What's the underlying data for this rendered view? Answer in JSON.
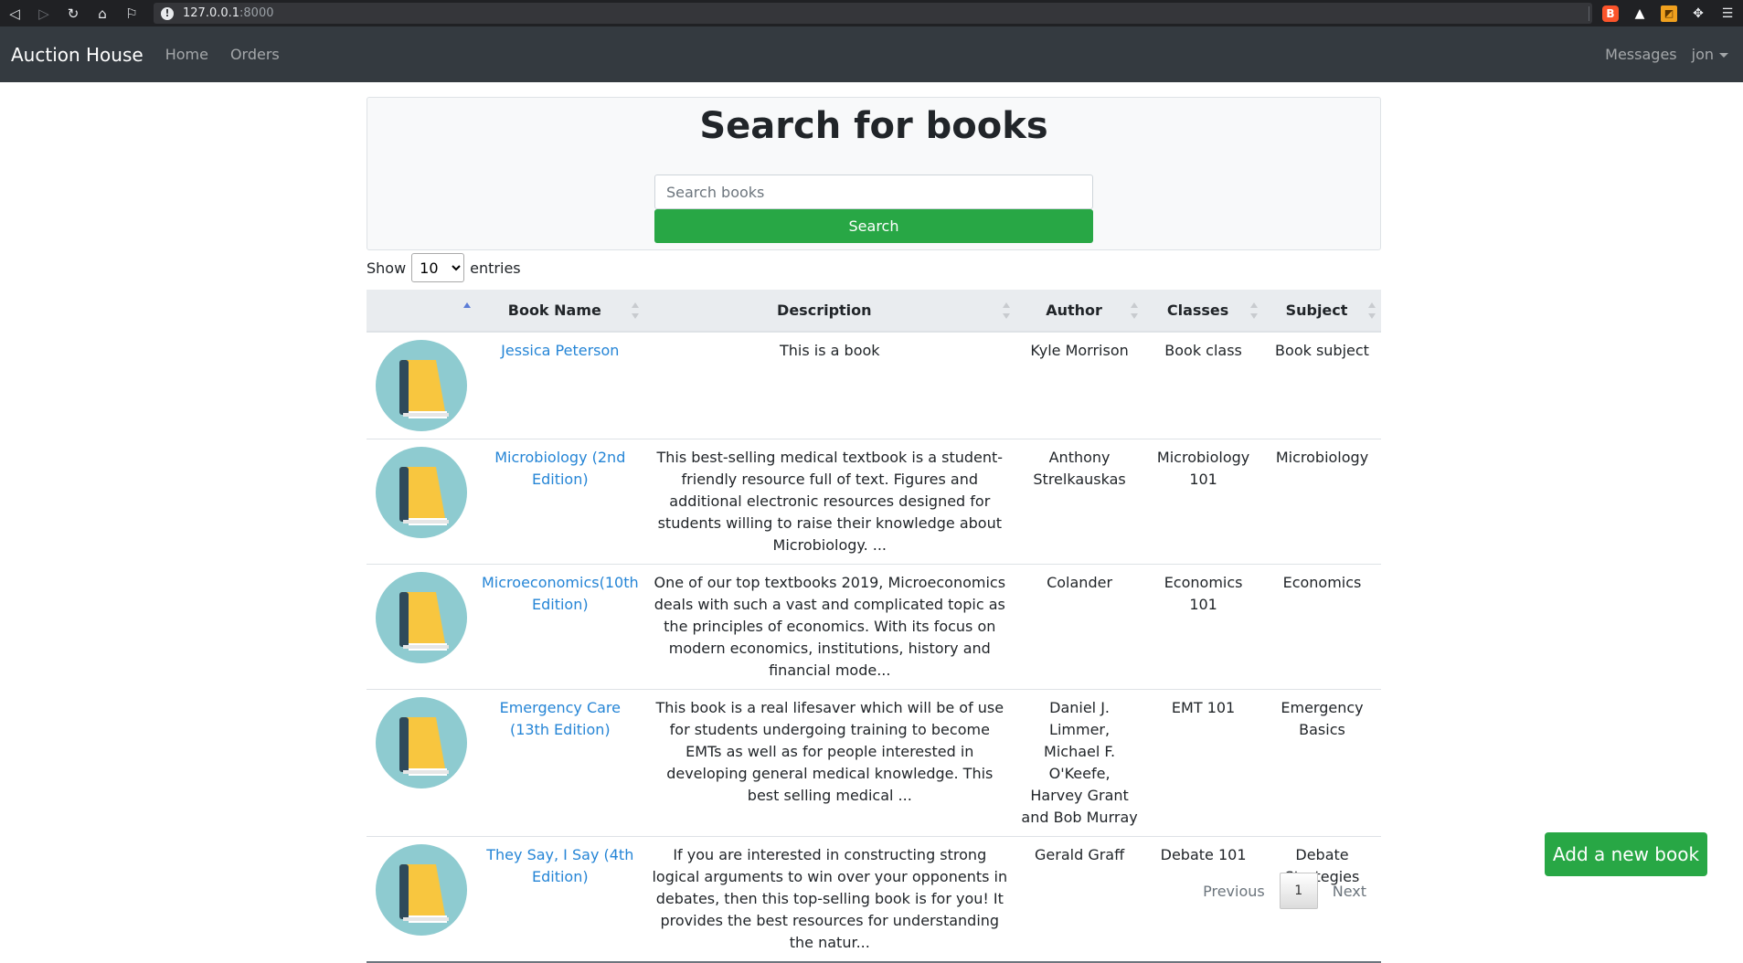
{
  "browser": {
    "url_host": "127.0.0.1",
    "url_port": ":8000"
  },
  "navbar": {
    "brand": "Auction House",
    "links": [
      "Home",
      "Orders"
    ],
    "messages": "Messages",
    "user": "jon"
  },
  "search": {
    "title": "Search for books",
    "placeholder": "Search books",
    "button": "Search"
  },
  "length": {
    "show": "Show",
    "value": "10",
    "entries": "entries"
  },
  "table": {
    "headers": [
      "",
      "Book Name",
      "Description",
      "Author",
      "Classes",
      "Subject"
    ],
    "rows": [
      {
        "name": "Jessica Peterson",
        "description": "This is a book",
        "author": "Kyle Morrison",
        "classes": "Book class",
        "subject": "Book subject"
      },
      {
        "name": "Microbiology (2nd Edition)",
        "description": "This best-selling medical textbook is a student-friendly resource full of text. Figures and additional electronic resources designed for students willing to raise their knowledge about Microbiology. ...",
        "author": "Anthony Strelkauskas",
        "classes": "Microbiology 101",
        "subject": "Microbiology"
      },
      {
        "name": "Microeconomics(10th Edition)",
        "description": "One of our top textbooks 2019, Microeconomics deals with such a vast and complicated topic as the principles of economics. With its focus on modern economics, institutions, history and financial mode...",
        "author": "Colander",
        "classes": "Economics 101",
        "subject": "Economics"
      },
      {
        "name": "Emergency Care (13th Edition)",
        "description": "This book is a real lifesaver which will be of use for students undergoing training to become EMTs as well as for people interested in developing general medical knowledge. This best selling medical ...",
        "author": "Daniel J. Limmer, Michael F. O'Keefe, Harvey Grant and Bob Murray",
        "classes": "EMT 101",
        "subject": "Emergency Basics"
      },
      {
        "name": "They Say, I Say (4th Edition)",
        "description": "If you are interested in constructing strong logical arguments to win over your opponents in debates, then this top-selling book is for you! It provides the best resources for understanding the natur...",
        "author": "Gerald Graff",
        "classes": "Debate 101",
        "subject": "Debate Strategies"
      }
    ]
  },
  "pagination": {
    "previous": "Previous",
    "current": "1",
    "next": "Next"
  },
  "add_book": "Add a new book",
  "colors": {
    "navbar": "#343a40",
    "success": "#28a745",
    "link": "#2585d6",
    "icon_circle": "#8ecbd0",
    "book_yellow": "#f8c63f",
    "book_spine": "#2e4a5b"
  }
}
